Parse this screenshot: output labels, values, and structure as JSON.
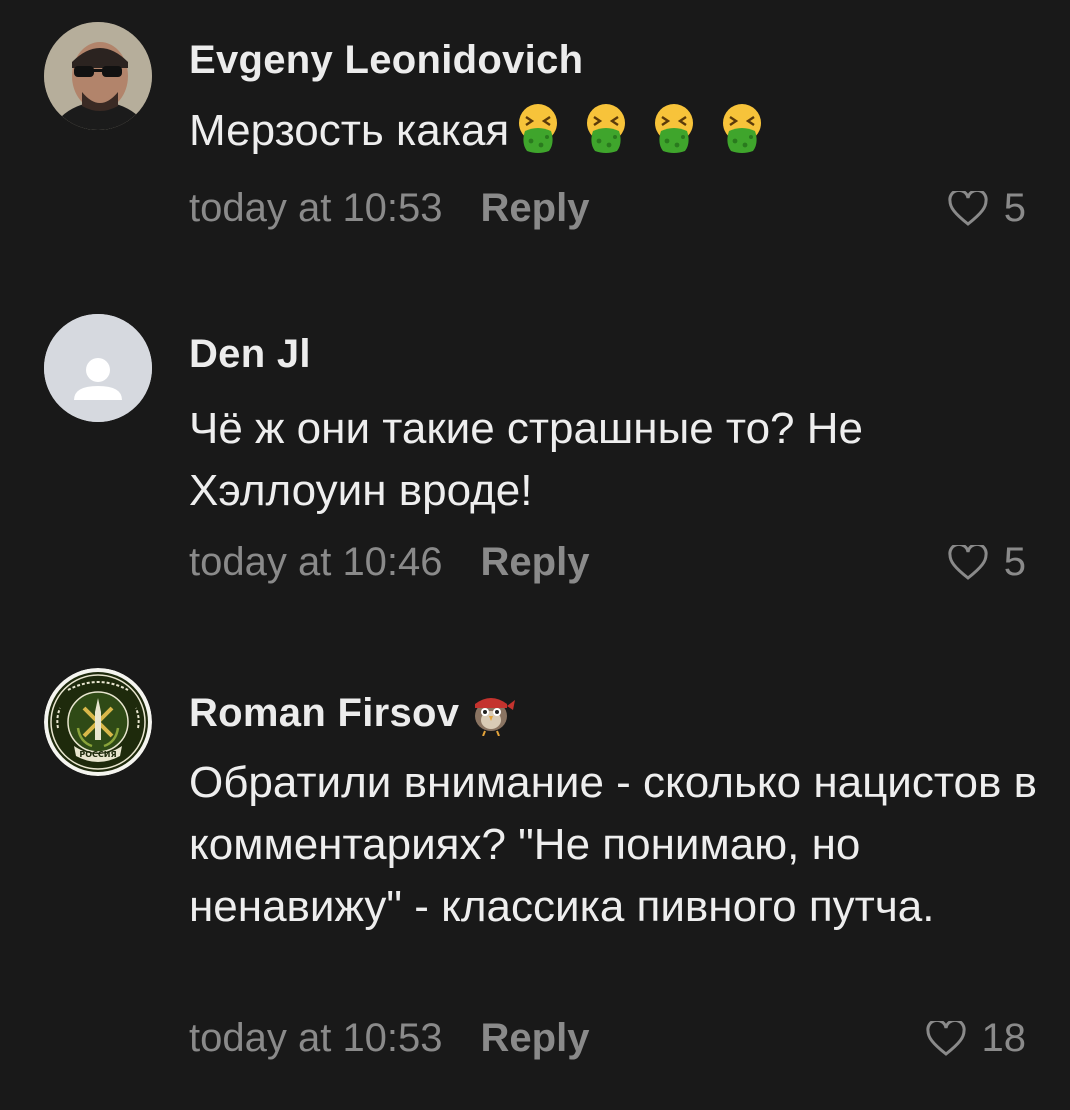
{
  "comments": [
    {
      "author": "Evgeny Leonidovich",
      "text": "Мерзость какая",
      "emojis": [
        "nauseated-face-icon",
        "nauseated-face-icon",
        "nauseated-face-icon",
        "nauseated-face-icon"
      ],
      "time": "today at 10:53",
      "reply_label": "Reply",
      "likes": "5"
    },
    {
      "author": "Den Jl",
      "text": "Чё ж они такие страшные то? Не Хэллоуин вроде!",
      "time": "today at 10:46",
      "reply_label": "Reply",
      "likes": "5"
    },
    {
      "author": "Roman Firsov",
      "author_badge": "bird-badge-icon",
      "text": "Обратили внимание - сколько нацистов в комментариях? \"Не понимаю, но ненавижу\" - классика пивного путча.",
      "avatar_emblem_text": "РАКЕТНЫЕ ВОЙСКА И АРТИЛЛЕРИЯ РОССИЯ",
      "time": "today at 10:53",
      "reply_label": "Reply",
      "likes": "18"
    }
  ],
  "colors": {
    "background": "#191919",
    "text": "#eeeeee",
    "muted": "#8a8a8a",
    "placeholder_avatar": "#d6d9df",
    "emblem_green": "#2f4a16",
    "emoji_green": "#3fa52c",
    "emoji_yellow": "#f7c33a"
  }
}
